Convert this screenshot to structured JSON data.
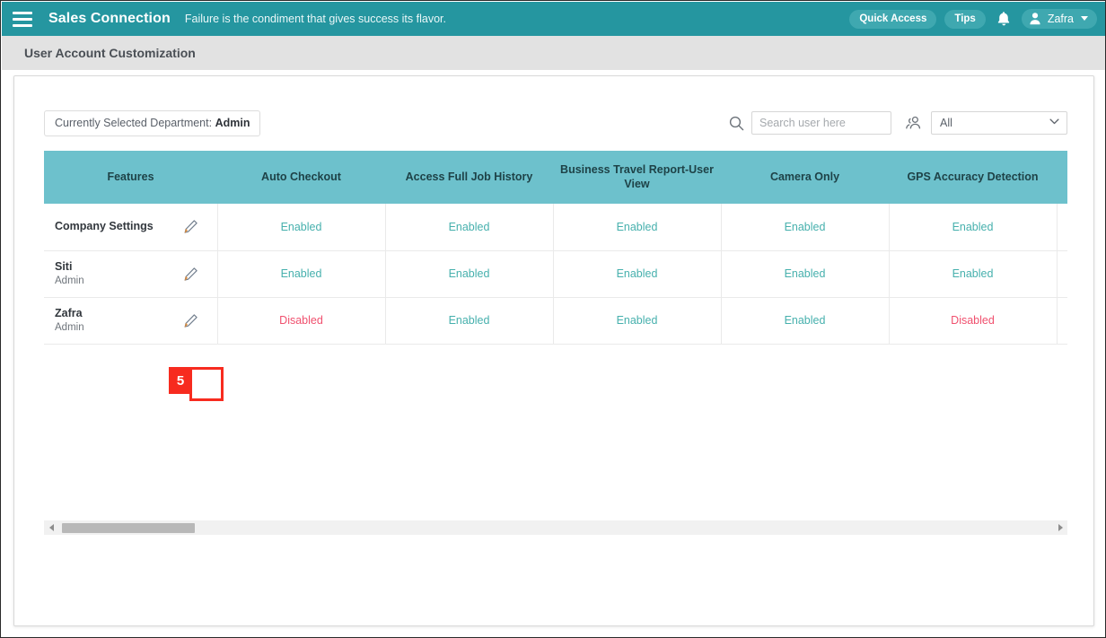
{
  "topnav": {
    "menu_icon": "hamburger-icon",
    "brand": "Sales Connection",
    "tagline": "Failure is the condiment that gives success its flavor.",
    "quick_access_label": "Quick Access",
    "tips_label": "Tips",
    "bell_icon": "notification-bell-icon",
    "user_name": "Zafra",
    "accent_color": "#2596a0",
    "pill_color": "#3fa8b0"
  },
  "pagebar": {
    "title": "User Account Customization"
  },
  "toolbar": {
    "department_prefix": "Currently Selected Department: ",
    "department_value": "Admin",
    "search_icon": "search-icon",
    "search_placeholder": "Search user here",
    "search_value": "",
    "people_icon": "people-group-icon",
    "filter_selected": "All",
    "filter_chevron": "chevron-down-icon"
  },
  "table": {
    "header_color": "#6dc1cc",
    "columns": [
      "Features",
      "Auto Checkout",
      "Access Full Job History",
      "Business Travel Report-User View",
      "Camera Only",
      "GPS Accuracy Detection",
      ""
    ],
    "rows": [
      {
        "name": "Company Settings",
        "role": "",
        "edit_icon": "edit-pencil-icon",
        "values": [
          "Enabled",
          "Enabled",
          "Enabled",
          "Enabled",
          "Enabled",
          ""
        ]
      },
      {
        "name": "Siti",
        "role": "Admin",
        "edit_icon": "edit-pencil-icon",
        "values": [
          "Enabled",
          "Enabled",
          "Enabled",
          "Enabled",
          "Enabled",
          ""
        ]
      },
      {
        "name": "Zafra",
        "role": "Admin",
        "edit_icon": "edit-pencil-icon",
        "values": [
          "Disabled",
          "Enabled",
          "Enabled",
          "Enabled",
          "Disabled",
          ""
        ]
      }
    ],
    "status_colors": {
      "enabled": "#46b0ad",
      "disabled": "#f0506e"
    }
  },
  "annotation": {
    "step_number": "5",
    "color": "#f72b1f"
  },
  "scrollbar": {
    "left_arrow_icon": "scroll-left-arrow-icon",
    "right_arrow_icon": "scroll-right-arrow-icon"
  }
}
